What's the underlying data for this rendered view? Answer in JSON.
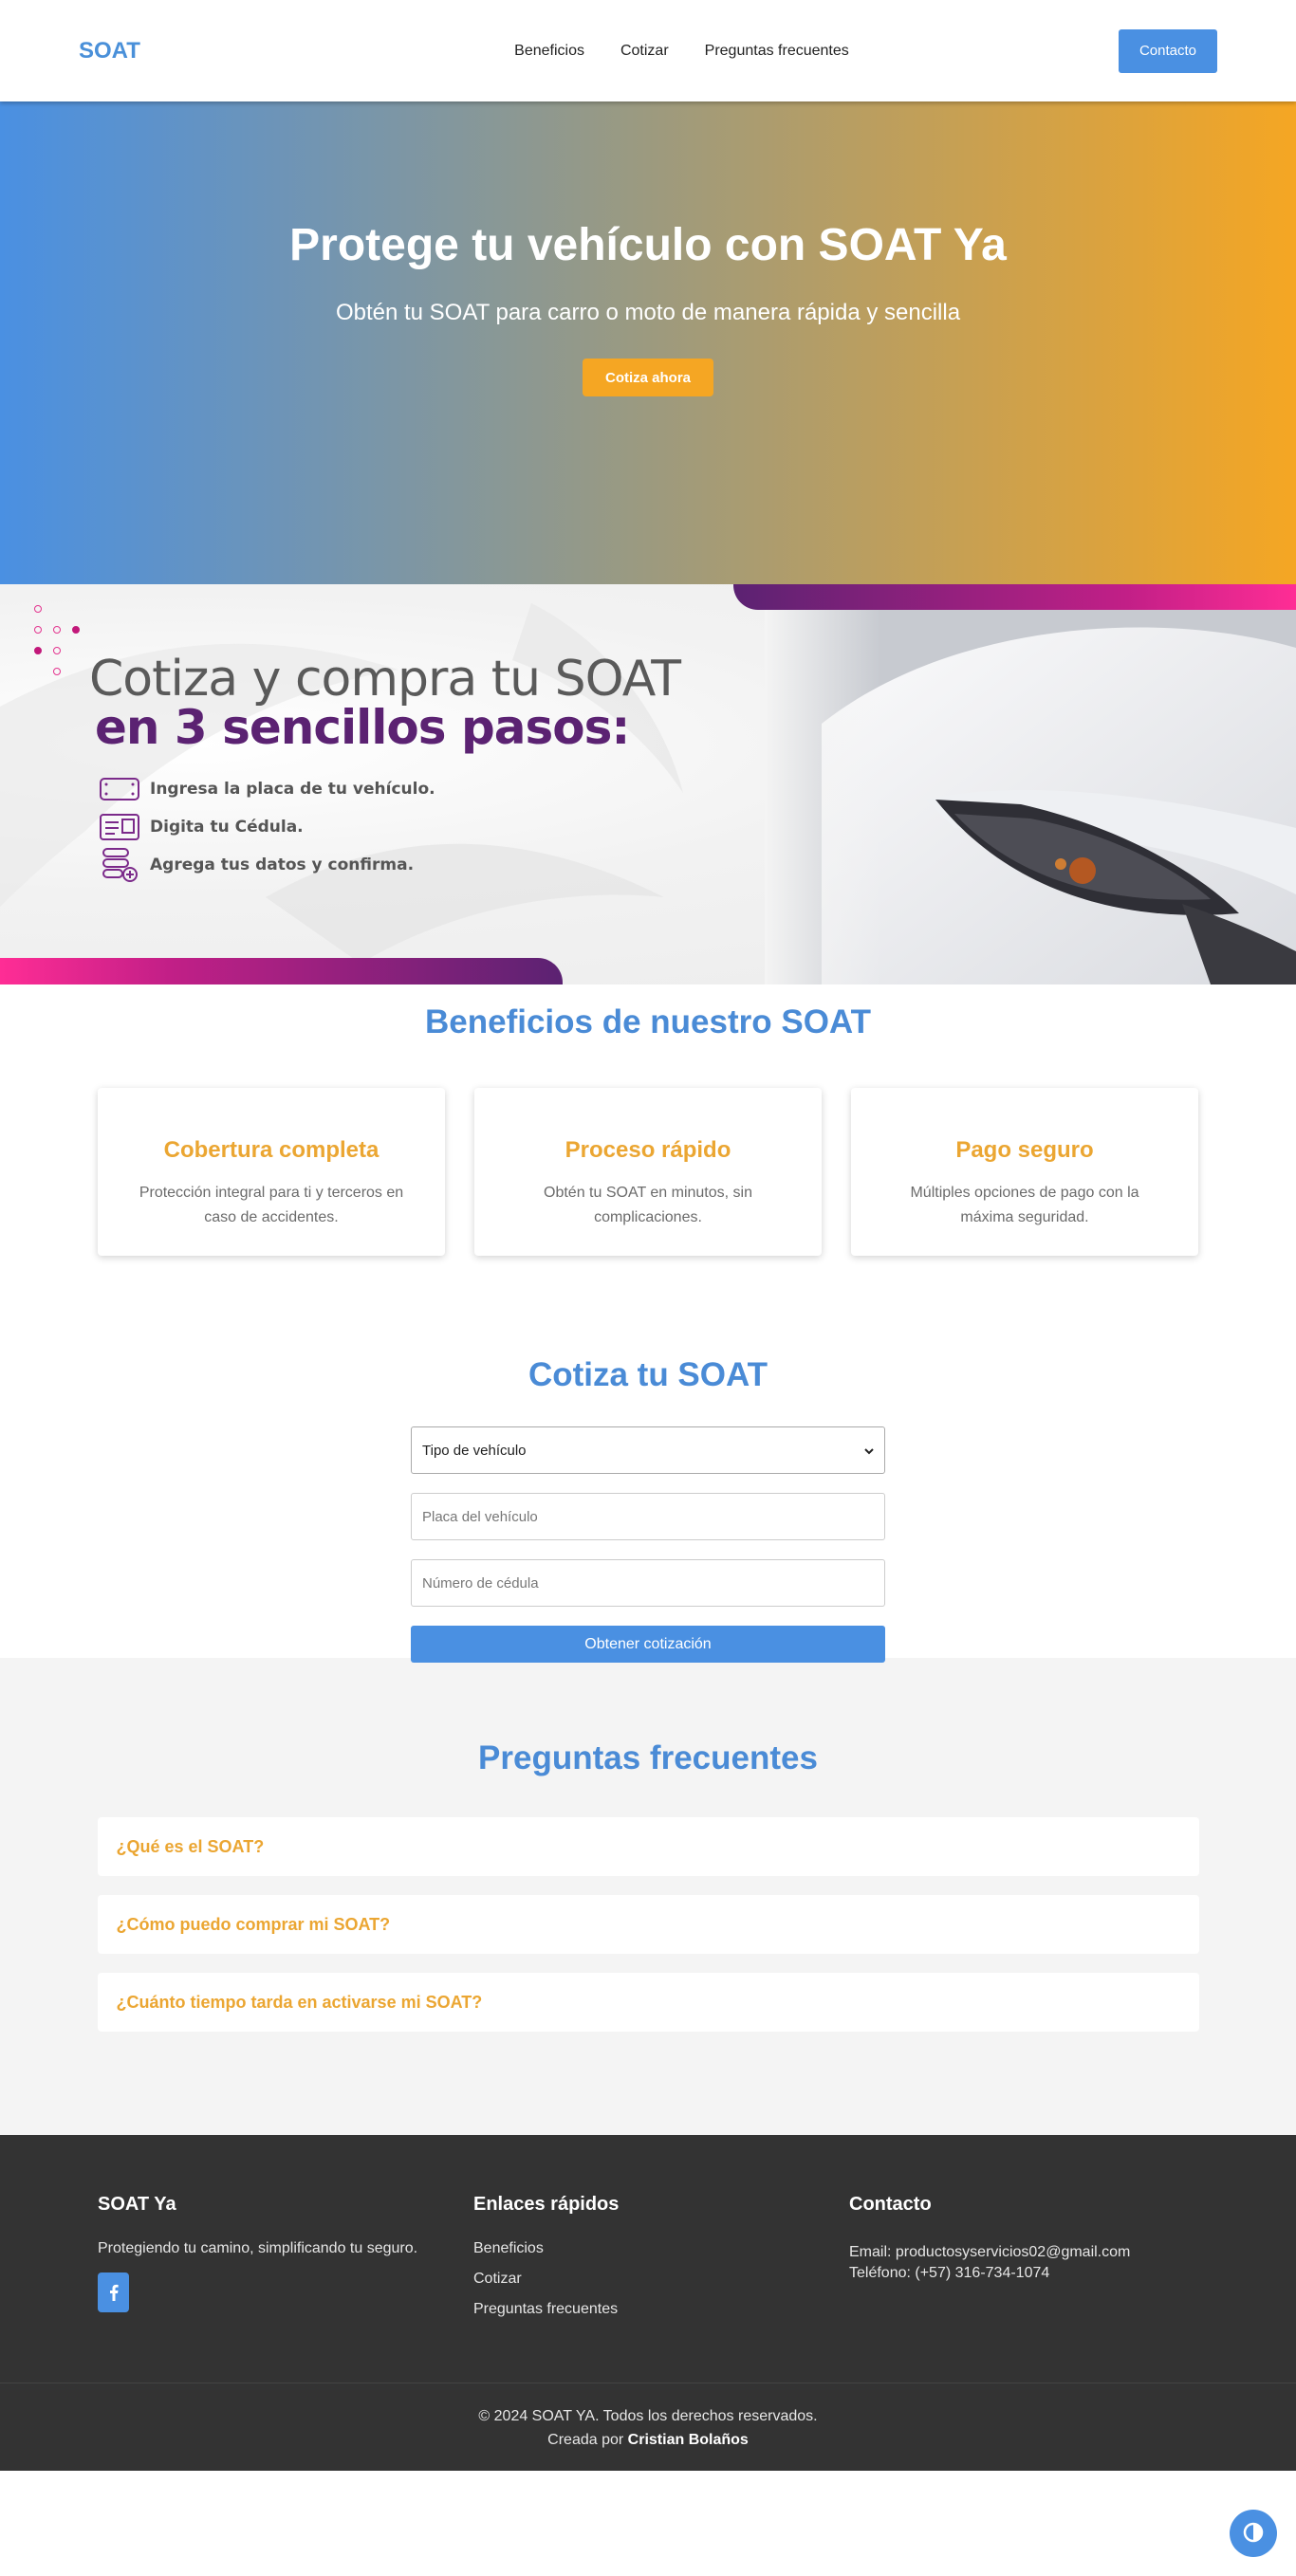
{
  "nav": {
    "logo": "SOAT",
    "links": [
      "Beneficios",
      "Cotizar",
      "Preguntas frecuentes"
    ],
    "contact_label": "Contacto"
  },
  "hero": {
    "title": "Protege tu vehículo con SOAT Ya",
    "subtitle": "Obtén tu SOAT para carro o moto de manera rápida y sencilla",
    "cta_label": "Cotiza ahora"
  },
  "banner": {
    "line1": "Cotiza y compra tu SOAT",
    "line2": "en 3 sencillos pasos:",
    "steps": [
      {
        "icon": "license-plate-icon",
        "text": "Ingresa la placa de tu vehículo."
      },
      {
        "icon": "id-card-icon",
        "text": "Digita tu Cédula."
      },
      {
        "icon": "data-stack-icon",
        "text": "Agrega tus datos y confirma."
      }
    ],
    "colors": {
      "purple": "#5b2272",
      "magenta": "#ff2d95"
    }
  },
  "benefits": {
    "title": "Beneficios de nuestro SOAT",
    "cards": [
      {
        "title": "Cobertura completa",
        "text": "Protección integral para ti y terceros en caso de accidentes."
      },
      {
        "title": "Proceso rápido",
        "text": "Obtén tu SOAT en minutos, sin complicaciones."
      },
      {
        "title": "Pago seguro",
        "text": "Múltiples opciones de pago con la máxima seguridad."
      }
    ]
  },
  "quote": {
    "title": "Cotiza tu SOAT",
    "vehicle_type_selected": "Tipo de vehículo",
    "plate_placeholder": "Placa del vehículo",
    "id_placeholder": "Número de cédula",
    "submit_label": "Obtener cotización"
  },
  "faq": {
    "title": "Preguntas frecuentes",
    "items": [
      "¿Qué es el SOAT?",
      "¿Cómo puedo comprar mi SOAT?",
      "¿Cuánto tiempo tarda en activarse mi SOAT?"
    ]
  },
  "footer": {
    "brand_title": "SOAT Ya",
    "brand_tagline": "Protegiendo tu camino, simplificando tu seguro.",
    "links_title": "Enlaces rápidos",
    "links": [
      "Beneficios",
      "Cotizar",
      "Preguntas frecuentes"
    ],
    "contact_title": "Contacto",
    "email": "Email: productosyservicios02@gmail.com",
    "phone": "Teléfono: (+57) 316-734-1074",
    "copyright": "© 2024 SOAT YA. Todos los derechos reservados.",
    "credit_prefix": "Creada por",
    "credit_name": "Cristian Bolaños"
  },
  "colors": {
    "primary": "#4a90e2",
    "accent": "#f5a623",
    "dark": "#333333"
  }
}
